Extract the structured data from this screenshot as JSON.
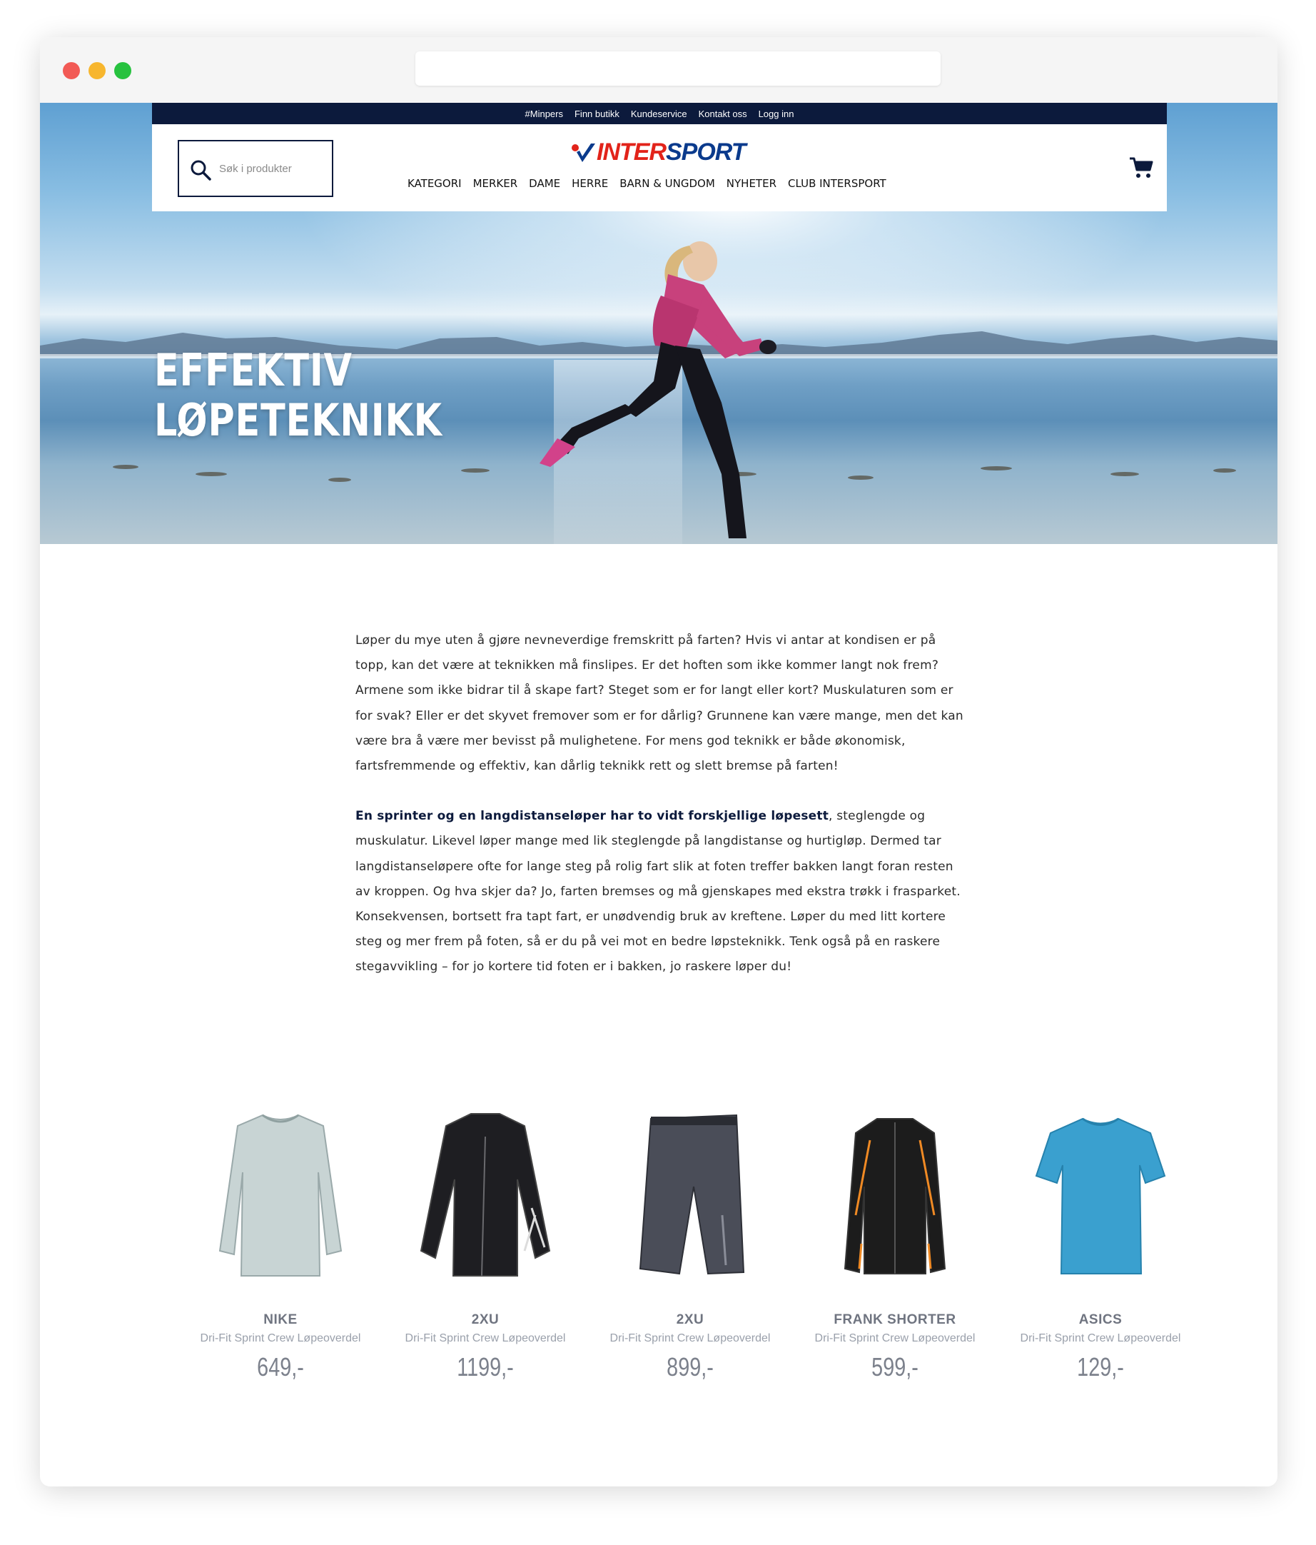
{
  "utility_links": [
    "#Minpers",
    "Finn butikk",
    "Kundeservice",
    "Kontakt oss",
    "Logg inn"
  ],
  "search": {
    "placeholder": "Søk i produkter"
  },
  "logo": {
    "part1": "INTER",
    "part2": "SPORT"
  },
  "nav": [
    "KATEGORI",
    "MERKER",
    "DAME",
    "HERRE",
    "BARN & UNGDOM",
    "NYHETER",
    "CLUB INTERSPORT"
  ],
  "hero": {
    "title_line1": "EFFEKTIV",
    "title_line2": "LØPETEKNIKK"
  },
  "article": {
    "p1": "Løper du mye uten å gjøre nevneverdige fremskritt på farten? Hvis vi antar at kondisen er på topp, kan det være at teknikken må finslipes. Er det hoften som ikke kommer langt nok frem? Armene som ikke bidrar til å skape fart? Steget som er for langt eller kort? Muskulaturen som er for svak? Eller er det skyvet fremover som er for dårlig? Grunnene kan være mange, men det kan være bra å være mer bevisst på mulighetene. For mens god teknikk er både økonomisk, fartsfremmende og effektiv, kan dårlig teknikk rett og slett bremse på farten!",
    "p2_bold": "En sprinter og en langdistanseløper har to vidt forskjellige løpesett",
    "p2_rest": ", steglengde og muskulatur. Likevel løper mange med lik steglengde på langdistanse og hurtigløp. Dermed tar langdistanseløpere ofte for lange steg på rolig fart slik at foten treffer bakken langt foran resten av kroppen. Og hva skjer da? Jo, farten bremses og må gjenskapes med ekstra trøkk i frasparket. Konsekvensen, bortsett fra tapt fart, er unødvendig bruk av kreftene. Løper du med litt kortere steg og mer frem på foten, så er du på vei mot en bedre løpsteknikk. Tenk også på en raskere stegavvikling – for jo kortere tid foten er i bakken, jo raskere løper du!"
  },
  "products": [
    {
      "brand": "NIKE",
      "name": "Dri-Fit Sprint Crew Løpeoverdel",
      "price": "649,-",
      "icon": "long-sleeve-shirt",
      "color": "#c8d4d4"
    },
    {
      "brand": "2XU",
      "name": "Dri-Fit Sprint Crew Løpeoverdel",
      "price": "1199,-",
      "icon": "compression-top",
      "color": "#1e1e22"
    },
    {
      "brand": "2XU",
      "name": "Dri-Fit Sprint Crew Løpeoverdel",
      "price": "899,-",
      "icon": "compression-shorts",
      "color": "#4a4d58"
    },
    {
      "brand": "FRANK SHORTER",
      "name": "Dri-Fit Sprint Crew Løpeoverdel",
      "price": "599,-",
      "icon": "running-jacket",
      "color": "#1c1c1c"
    },
    {
      "brand": "ASICS",
      "name": "Dri-Fit Sprint Crew Løpeoverdel",
      "price": "129,-",
      "icon": "t-shirt",
      "color": "#3aa0cf"
    }
  ],
  "colors": {
    "navy": "#0c1a3c",
    "logo_red": "#e2231a",
    "logo_blue": "#0a3a8c"
  }
}
